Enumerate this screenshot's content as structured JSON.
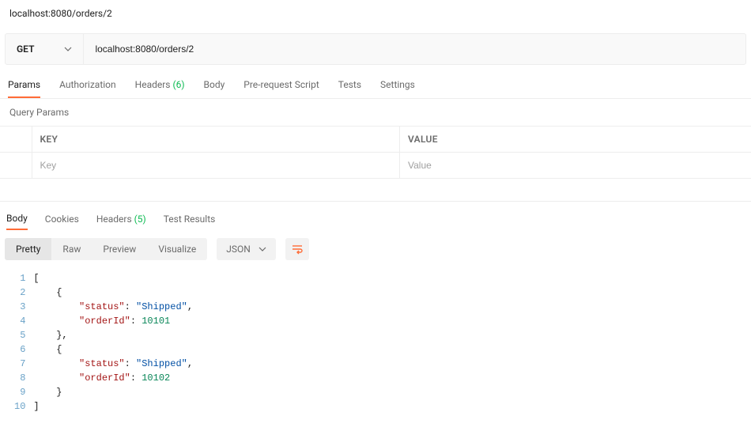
{
  "request": {
    "name": "localhost:8080/orders/2",
    "method": "GET",
    "url": "localhost:8080/orders/2"
  },
  "request_tabs": [
    {
      "label": "Params",
      "active": true
    },
    {
      "label": "Authorization"
    },
    {
      "label": "Headers",
      "count": "(6)"
    },
    {
      "label": "Body"
    },
    {
      "label": "Pre-request Script"
    },
    {
      "label": "Tests"
    },
    {
      "label": "Settings"
    }
  ],
  "query_params": {
    "section_label": "Query Params",
    "headers": {
      "key": "KEY",
      "value": "VALUE"
    },
    "placeholder": {
      "key": "Key",
      "value": "Value"
    }
  },
  "response_tabs": [
    {
      "label": "Body",
      "active": true
    },
    {
      "label": "Cookies"
    },
    {
      "label": "Headers",
      "count": "(5)"
    },
    {
      "label": "Test Results"
    }
  ],
  "view_modes": [
    {
      "label": "Pretty",
      "active": true
    },
    {
      "label": "Raw"
    },
    {
      "label": "Preview"
    },
    {
      "label": "Visualize"
    }
  ],
  "format_select": "JSON",
  "response_body": [
    {
      "status": "Shipped",
      "orderId": 10101
    },
    {
      "status": "Shipped",
      "orderId": 10102
    }
  ],
  "code_lines": [
    {
      "n": 1,
      "tokens": [
        {
          "t": "[",
          "c": "punc"
        }
      ]
    },
    {
      "n": 2,
      "tokens": [
        {
          "t": "    ",
          "c": "punc"
        },
        {
          "t": "{",
          "c": "punc"
        }
      ]
    },
    {
      "n": 3,
      "tokens": [
        {
          "t": "        ",
          "c": "punc"
        },
        {
          "t": "\"status\"",
          "c": "key"
        },
        {
          "t": ": ",
          "c": "punc"
        },
        {
          "t": "\"Shipped\"",
          "c": "string"
        },
        {
          "t": ",",
          "c": "punc"
        }
      ]
    },
    {
      "n": 4,
      "tokens": [
        {
          "t": "        ",
          "c": "punc"
        },
        {
          "t": "\"orderId\"",
          "c": "key"
        },
        {
          "t": ": ",
          "c": "punc"
        },
        {
          "t": "10101",
          "c": "number"
        }
      ]
    },
    {
      "n": 5,
      "tokens": [
        {
          "t": "    ",
          "c": "punc"
        },
        {
          "t": "},",
          "c": "punc"
        }
      ]
    },
    {
      "n": 6,
      "tokens": [
        {
          "t": "    ",
          "c": "punc"
        },
        {
          "t": "{",
          "c": "punc"
        }
      ]
    },
    {
      "n": 7,
      "tokens": [
        {
          "t": "        ",
          "c": "punc"
        },
        {
          "t": "\"status\"",
          "c": "key"
        },
        {
          "t": ": ",
          "c": "punc"
        },
        {
          "t": "\"Shipped\"",
          "c": "string"
        },
        {
          "t": ",",
          "c": "punc"
        }
      ]
    },
    {
      "n": 8,
      "tokens": [
        {
          "t": "        ",
          "c": "punc"
        },
        {
          "t": "\"orderId\"",
          "c": "key"
        },
        {
          "t": ": ",
          "c": "punc"
        },
        {
          "t": "10102",
          "c": "number"
        }
      ]
    },
    {
      "n": 9,
      "tokens": [
        {
          "t": "    ",
          "c": "punc"
        },
        {
          "t": "}",
          "c": "punc"
        }
      ]
    },
    {
      "n": 10,
      "tokens": [
        {
          "t": "]",
          "c": "punc"
        }
      ]
    }
  ]
}
